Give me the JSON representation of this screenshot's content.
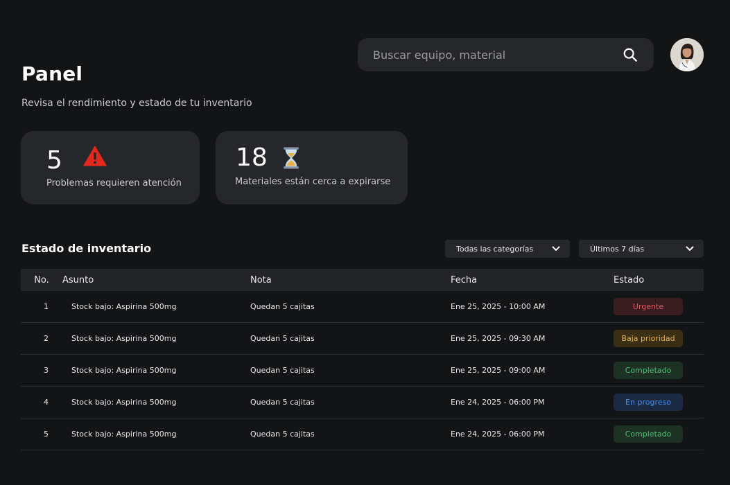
{
  "header": {
    "search_placeholder": "Buscar equipo, material",
    "title": "Panel",
    "subtitle": "Revisa el rendimiento y estado de tu inventario"
  },
  "cards": [
    {
      "value": "5",
      "label": "Problemas requieren atención",
      "icon": "warning-icon",
      "icon_color": "#e0281d"
    },
    {
      "value": "18",
      "label": "Materiales están cerca a expirarse",
      "icon": "hourglass-icon",
      "icon_color": "#e8b04a"
    }
  ],
  "inventory": {
    "title": "Estado de inventario",
    "filters": {
      "category": "Todas las categorías",
      "period": "Últimos 7 días"
    },
    "columns": [
      "No.",
      "Asunto",
      "Nota",
      "Fecha",
      "Estado"
    ],
    "rows": [
      {
        "no": "1",
        "asunto": "Stock bajo: Aspirina 500mg",
        "nota": "Quedan 5 cajitas",
        "fecha": "Ene 25, 2025 - 10:00 AM",
        "estado": "Urgente",
        "status": "urgent"
      },
      {
        "no": "2",
        "asunto": "Stock bajo: Aspirina 500mg",
        "nota": "Quedan 5 cajitas",
        "fecha": "Ene 25, 2025 - 09:30 AM",
        "estado": "Baja prioridad",
        "status": "low"
      },
      {
        "no": "3",
        "asunto": "Stock bajo: Aspirina 500mg",
        "nota": "Quedan 5 cajitas",
        "fecha": "Ene 25, 2025 - 09:00 AM",
        "estado": "Completado",
        "status": "done"
      },
      {
        "no": "4",
        "asunto": "Stock bajo: Aspirina 500mg",
        "nota": "Quedan 5 cajitas",
        "fecha": "Ene 24, 2025 - 06:00 PM",
        "estado": "En progreso",
        "status": "progress"
      },
      {
        "no": "5",
        "asunto": "Stock bajo: Aspirina 500mg",
        "nota": "Quedan 5 cajitas",
        "fecha": "Ene 24, 2025 - 06:00 PM",
        "estado": "Completado",
        "status": "done"
      }
    ]
  },
  "status_colors": {
    "urgent": {
      "bg": "#3a1d21",
      "fg": "#e0555f"
    },
    "low": {
      "bg": "#3a2f15",
      "fg": "#e2b34a"
    },
    "done": {
      "bg": "#1c3024",
      "fg": "#4cc274"
    },
    "progress": {
      "bg": "#1b2a42",
      "fg": "#4b8fe6"
    }
  }
}
